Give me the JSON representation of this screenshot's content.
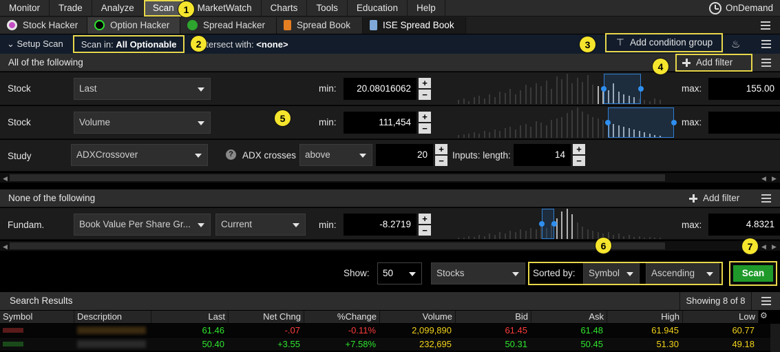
{
  "menu": {
    "items": [
      "Monitor",
      "Trade",
      "Analyze",
      "Scan",
      "MarketWatch",
      "Charts",
      "Tools",
      "Education",
      "Help"
    ],
    "active": "Scan",
    "ondemand": "OnDemand"
  },
  "tabs": [
    {
      "label": "Stock Hacker",
      "icon": "stock-hacker-icon"
    },
    {
      "label": "Option Hacker",
      "icon": "option-hacker-icon"
    },
    {
      "label": "Spread Hacker",
      "icon": "spread-hacker-icon"
    },
    {
      "label": "Spread Book",
      "icon": "spread-book-icon"
    },
    {
      "label": "ISE Spread Book",
      "icon": "ise-spread-book-icon"
    }
  ],
  "setup": {
    "label": "Setup Scan",
    "scan_in_label": "Scan in:",
    "scan_in_value": "All Optionable",
    "intersect_label": "Intersect with:",
    "intersect_value": "<none>",
    "add_condition_group": "Add condition group"
  },
  "all_section": {
    "title": "All of the following",
    "add_filter": "Add filter",
    "rows": [
      {
        "label": "Stock",
        "field": "Last",
        "min_label": "min:",
        "min": "20.08016062",
        "max_label": "max:",
        "max": "155.00"
      },
      {
        "label": "Stock",
        "field": "Volume",
        "min_label": "min:",
        "min": "111,454",
        "max_label": "max:",
        "max": ""
      },
      {
        "label": "Study",
        "field": "ADXCrossover",
        "crosses_label": "ADX crosses",
        "crosses_value": "above",
        "threshold": "20",
        "inputs_label": "Inputs: length:",
        "length": "14"
      }
    ]
  },
  "none_section": {
    "title": "None of the following",
    "add_filter": "Add filter",
    "row": {
      "label": "Fundam.",
      "field": "Book Value Per Share Gr...",
      "period": "Current",
      "min_label": "min:",
      "min": "-8.2719",
      "max_label": "max:",
      "max": "4.8321"
    }
  },
  "controls": {
    "show_label": "Show:",
    "show_value": "50",
    "type_value": "Stocks",
    "sorted_by_label": "Sorted by:",
    "sort_field": "Symbol",
    "sort_order": "Ascending",
    "scan_button": "Scan"
  },
  "results": {
    "title": "Search Results",
    "showing": "Showing 8 of 8",
    "columns": [
      "Symbol",
      "Description",
      "Last",
      "Net Chng",
      "%Change",
      "Volume",
      "Bid",
      "Ask",
      "High",
      "Low"
    ],
    "rows": [
      {
        "last": "61.46",
        "net": "-.07",
        "pct": "-0.11%",
        "volume": "2,099,890",
        "bid": "61.45",
        "ask": "61.48",
        "high": "61.945",
        "low": "60.77"
      },
      {
        "last": "50.40",
        "net": "+3.55",
        "pct": "+7.58%",
        "volume": "232,695",
        "bid": "50.31",
        "ask": "50.45",
        "high": "51.30",
        "low": "49.18"
      }
    ]
  },
  "annotations": [
    "1",
    "2",
    "3",
    "4",
    "5",
    "6",
    "7"
  ],
  "colors": {
    "highlight": "#e8d84a",
    "badge": "#f5e52d",
    "scan_green": "#1f9a2a",
    "positive": "#2ee62e",
    "negative": "#ff3b3b",
    "volume": "#f2d21a"
  }
}
